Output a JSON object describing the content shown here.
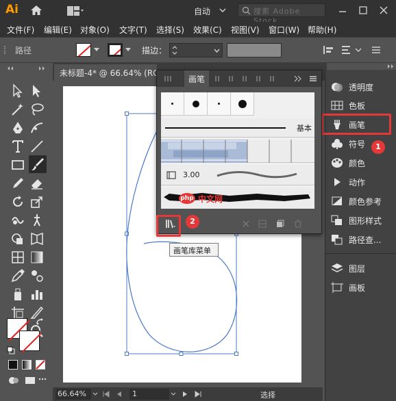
{
  "titlebar": {
    "app_logo": "Ai",
    "workspace": "自动",
    "search_placeholder": "搜索 Adobe Stock",
    "icons": [
      "home-icon",
      "workspace-switcher-icon",
      "search-icon",
      "minimize-icon",
      "maximize-icon",
      "close-icon"
    ]
  },
  "menubar": {
    "items": [
      "文件(F)",
      "编辑(E)",
      "对象(O)",
      "文字(T)",
      "选择(S)",
      "效果(C)",
      "视图(V)",
      "窗口(W)",
      "帮助(H)"
    ]
  },
  "controlbar": {
    "selection_label": "路径",
    "stroke_label": "描边："
  },
  "document": {
    "tab_title": "未标题-4* @ 66.64% (RG"
  },
  "statusbar": {
    "zoom": "66.64%",
    "artboard": "1",
    "status": "选择"
  },
  "right_panel": {
    "items": [
      {
        "label": "透明度",
        "icon": "transparency-icon"
      },
      {
        "label": "色板",
        "icon": "swatches-icon"
      },
      {
        "label": "画笔",
        "icon": "brush-icon"
      },
      {
        "label": "符号",
        "icon": "symbols-icon"
      },
      {
        "label": "颜色",
        "icon": "color-icon"
      },
      {
        "label": "动作",
        "icon": "actions-icon"
      },
      {
        "label": "颜色参考",
        "icon": "color-guide-icon"
      },
      {
        "label": "图形样式",
        "icon": "graphic-styles-icon"
      },
      {
        "label": "路径查...",
        "icon": "pathfinder-icon"
      },
      {
        "label": "图层",
        "icon": "layers-icon"
      },
      {
        "label": "画板",
        "icon": "artboards-icon"
      }
    ]
  },
  "brush_panel": {
    "tab_label": "画笔",
    "basic_label": "基本",
    "bristle_value": "3.00",
    "watermark_logo": "php",
    "watermark_text": "中文网",
    "tooltip": "画笔库菜单"
  },
  "annotations": {
    "badge_1": "1",
    "badge_2": "2",
    "highlight_color": "#e53838"
  },
  "colors": {
    "app_chrome": "#323232",
    "panel": "#535353",
    "accent_logo": "#ff9a00",
    "path_stroke": "#4a78c8"
  }
}
